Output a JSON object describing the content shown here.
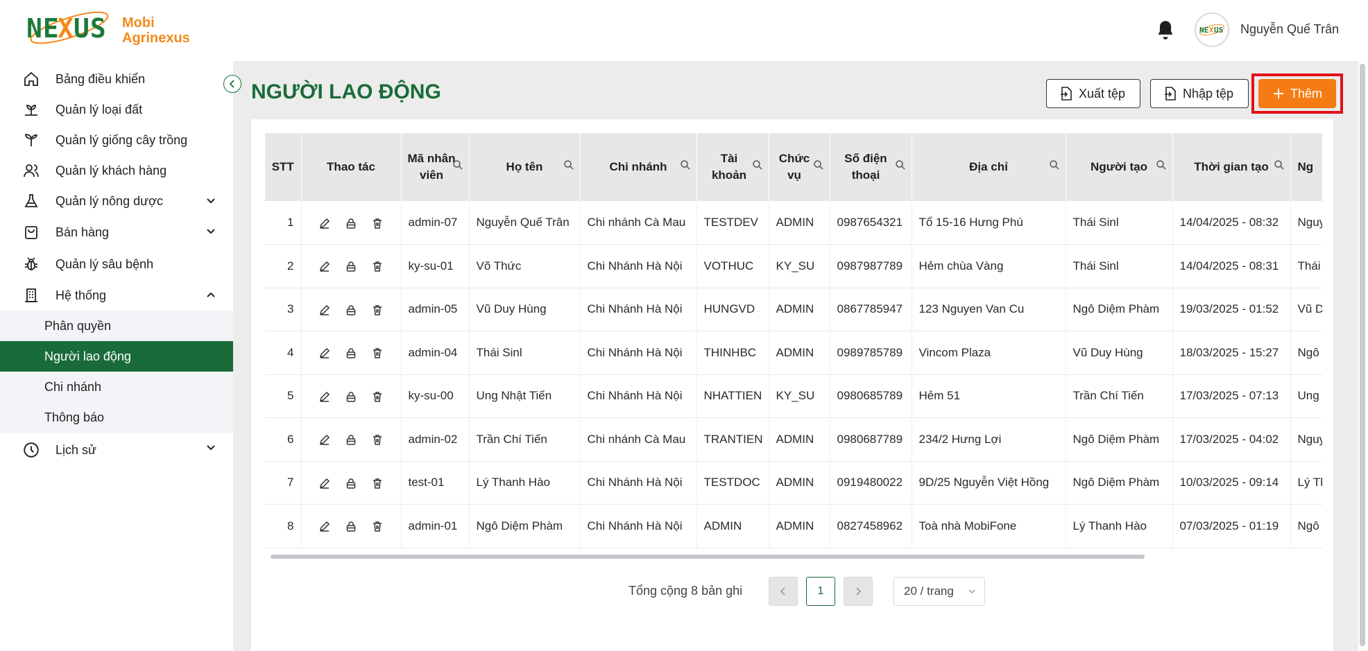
{
  "brand": {
    "logo_word": "NEXUS",
    "line1": "Mobi",
    "line2": "Agrinexus",
    "avatar_text": "NEXUS"
  },
  "user": {
    "name": "Nguyễn Quế Trân"
  },
  "sidebar": {
    "items": [
      {
        "label": "Bảng điều khiển",
        "icon": "home-icon"
      },
      {
        "label": "Quản lý loại đất",
        "icon": "soil-icon"
      },
      {
        "label": "Quản lý giống cây trồng",
        "icon": "plant-icon"
      },
      {
        "label": "Quản lý khách hàng",
        "icon": "users-icon"
      },
      {
        "label": "Quản lý nông dược",
        "icon": "flask-icon"
      },
      {
        "label": "Bán hàng",
        "icon": "bag-icon"
      },
      {
        "label": "Quản lý sâu bệnh",
        "icon": "bug-icon"
      },
      {
        "label": "Hệ thống",
        "icon": "building-icon"
      }
    ],
    "system_sub": [
      "Phân quyền",
      "Người lao động",
      "Chi nhánh",
      "Thông báo"
    ],
    "history": {
      "label": "Lịch sử",
      "icon": "clock-icon"
    }
  },
  "page": {
    "title": "NGƯỜI LAO ĐỘNG",
    "export_label": "Xuất tệp",
    "import_label": "Nhập tệp",
    "add_label": "Thêm"
  },
  "table": {
    "headers": [
      "STT",
      "Thao tác",
      "Mã nhân viên",
      "Họ tên",
      "Chi nhánh",
      "Tài khoản",
      "Chức vụ",
      "Số điện thoại",
      "Địa chỉ",
      "Người tạo",
      "Thời gian tạo",
      "Ng"
    ],
    "rows": [
      [
        "1",
        "admin-07",
        "Nguyễn Quế Trân",
        "Chi nhánh Cà Mau",
        "TESTDEV",
        "ADMIN",
        "0987654321",
        "Tổ 15-16 Hưng Phú",
        "Thái Sinl",
        "14/04/2025 - 08:32",
        "Nguy"
      ],
      [
        "2",
        "ky-su-01",
        "Võ Thức",
        "Chi Nhánh Hà Nội",
        "VOTHUC",
        "KY_SU",
        "0987987789",
        "Hẻm chùa Vàng",
        "Thái Sinl",
        "14/04/2025 - 08:31",
        "Thái"
      ],
      [
        "3",
        "admin-05",
        "Vũ Duy Hùng",
        "Chi Nhánh Hà Nội",
        "HUNGVD",
        "ADMIN",
        "0867785947",
        "123 Nguyen Van Cu",
        "Ngô Diệm Phàm",
        "19/03/2025 - 01:52",
        "Vũ D"
      ],
      [
        "4",
        "admin-04",
        "Thái Sinl",
        "Chi Nhánh Hà Nội",
        "THINHBC",
        "ADMIN",
        "0989785789",
        "Vincom Plaza",
        "Vũ Duy Hùng",
        "18/03/2025 - 15:27",
        "Ngô"
      ],
      [
        "5",
        "ky-su-00",
        "Ung Nhật Tiến",
        "Chi Nhánh Hà Nội",
        "NHATTIEN",
        "KY_SU",
        "0980685789",
        "Hẻm 51",
        "Trần Chí Tiến",
        "17/03/2025 - 07:13",
        "Ung"
      ],
      [
        "6",
        "admin-02",
        "Trần Chí Tiến",
        "Chi nhánh Cà Mau",
        "TRANTIEN",
        "ADMIN",
        "0980687789",
        "234/2 Hưng Lợi",
        "Ngô Diệm Phàm",
        "17/03/2025 - 04:02",
        "Nguy"
      ],
      [
        "7",
        "test-01",
        "Lý Thanh Hào",
        "Chi Nhánh Hà Nội",
        "TESTDOC",
        "ADMIN",
        "0919480022",
        "9D/25 Nguyễn Việt Hồng",
        "Ngô Diệm Phàm",
        "10/03/2025 - 09:14",
        "Lý Th"
      ],
      [
        "8",
        "admin-01",
        "Ngô Diệm Phàm",
        "Chi Nhánh Hà Nội",
        "ADMIN",
        "ADMIN",
        "0827458962",
        "Toà nhà MobiFone",
        "Lý Thanh Hào",
        "07/03/2025 - 01:19",
        "Ngô"
      ]
    ]
  },
  "pagination": {
    "total_text": "Tổng cộng 8 bản ghi",
    "current_page": "1",
    "page_size": "20 / trang"
  },
  "colors": {
    "primary": "#1a6b3a",
    "accent": "#f57c14",
    "highlight": "#e3101a"
  }
}
